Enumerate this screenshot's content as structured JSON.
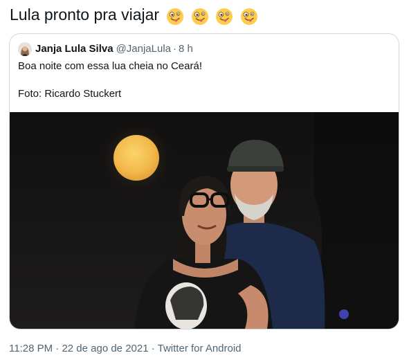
{
  "tweet": {
    "text": "Lula pronto pra viajar",
    "emojis": [
      "zany-face",
      "zany-face",
      "zany-face",
      "zany-face"
    ]
  },
  "quoted_tweet": {
    "display_name": "Janja Lula Silva",
    "handle": "@JanjaLula",
    "separator": "·",
    "time": "8 h",
    "line1": "Boa noite com essa lua cheia no Ceará!",
    "line2": "Foto: Ricardo Stuckert"
  },
  "meta": {
    "time": "11:28 PM",
    "sep1": "·",
    "date": "22 de ago de 2021",
    "sep2": "·",
    "source": "Twitter for Android"
  },
  "colors": {
    "text": "#0f1419",
    "muted": "#536471",
    "border": "#cfd9de",
    "moon": "#f6c45a",
    "night": "#0d0c0c"
  }
}
